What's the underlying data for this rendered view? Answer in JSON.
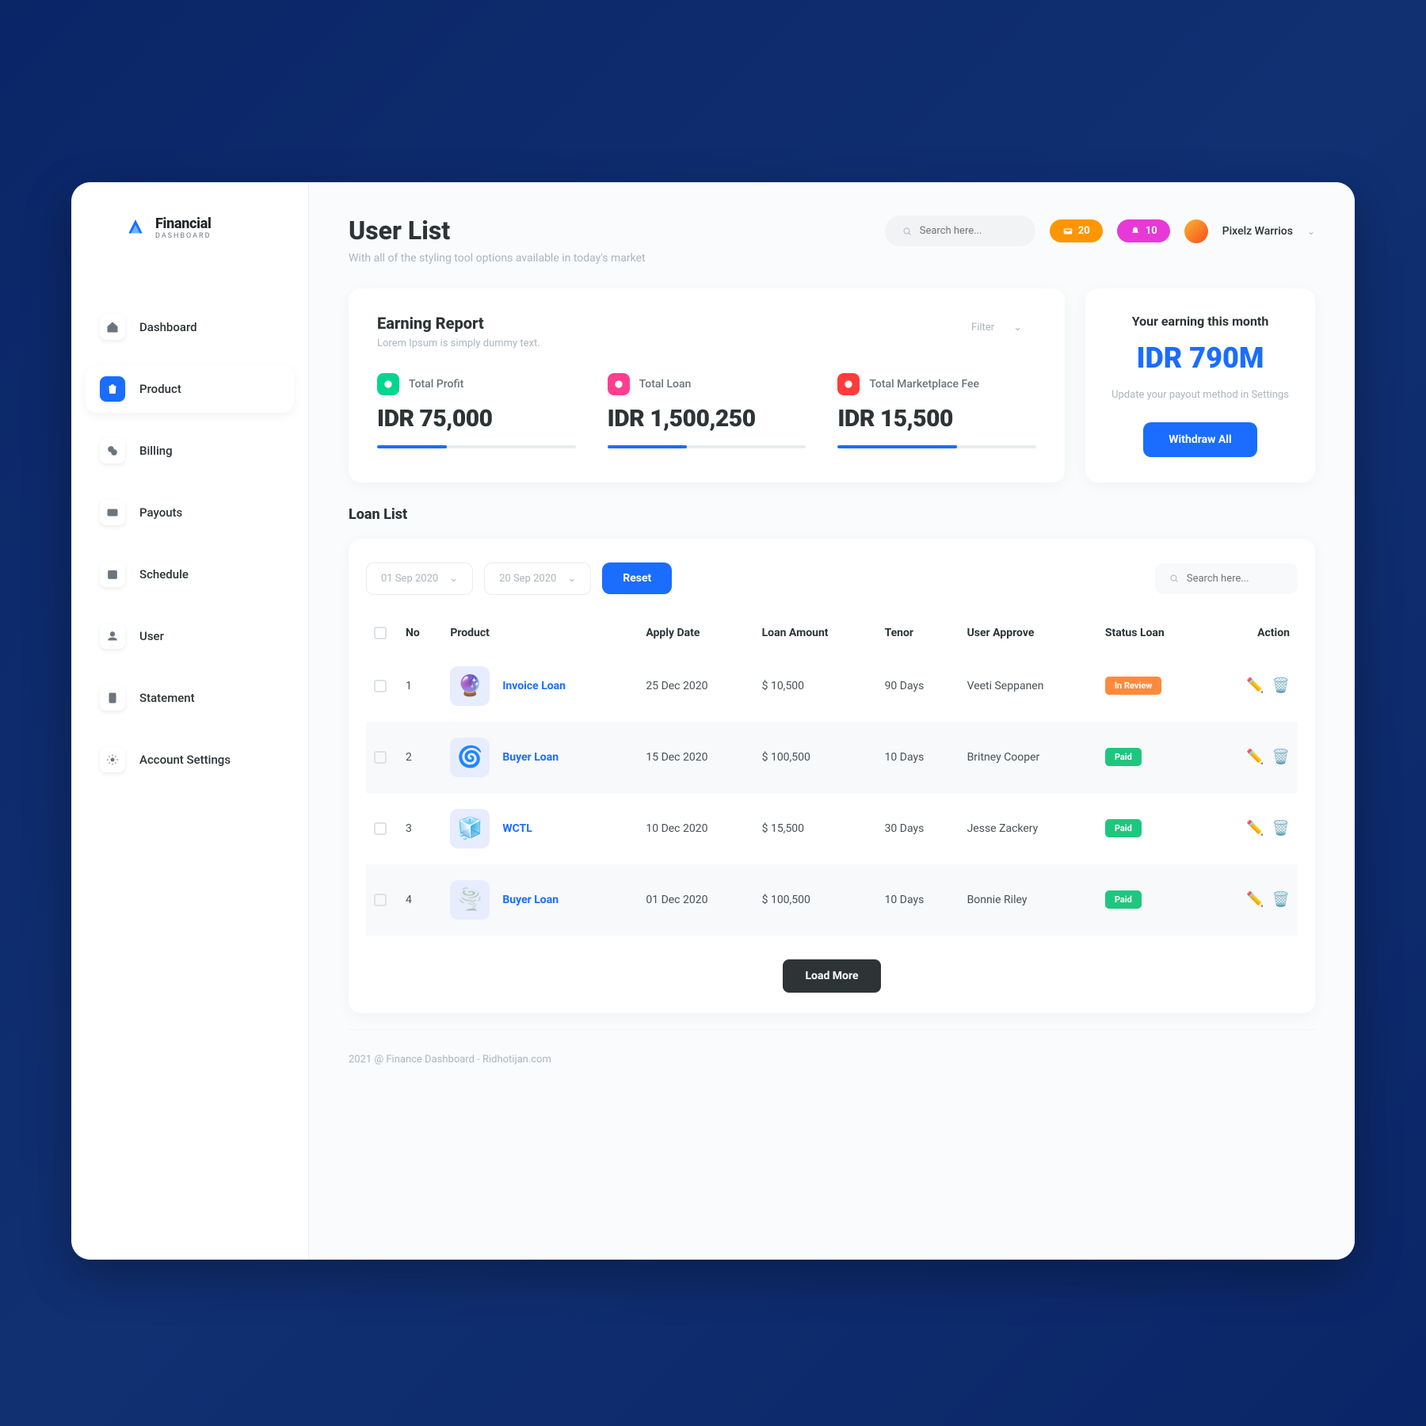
{
  "brand": {
    "title": "Financial",
    "subtitle": "Dashboard"
  },
  "nav": {
    "items": [
      {
        "label": "Dashboard",
        "icon": "home"
      },
      {
        "label": "Product",
        "icon": "bag",
        "active": true
      },
      {
        "label": "Billing",
        "icon": "coins"
      },
      {
        "label": "Payouts",
        "icon": "wallet"
      },
      {
        "label": "Schedule",
        "icon": "calendar"
      },
      {
        "label": "User",
        "icon": "user"
      },
      {
        "label": "Statement",
        "icon": "file"
      },
      {
        "label": "Account Settings",
        "icon": "gear"
      }
    ]
  },
  "header": {
    "title": "User List",
    "subtitle": "With all of the styling tool options available in today's market",
    "search_placeholder": "Search here...",
    "badge_orange": "20",
    "badge_pink": "10",
    "user_name": "Pixelz Warrios"
  },
  "earning": {
    "title": "Earning Report",
    "subtitle": "Lorem Ipsum is simply dummy text.",
    "filter_label": "Filter",
    "metrics": [
      {
        "label": "Total Profit",
        "value": "IDR 75,000",
        "progress": 35,
        "color": "green"
      },
      {
        "label": "Total Loan",
        "value": "IDR 1,500,250",
        "progress": 40,
        "color": "pink"
      },
      {
        "label": "Total Marketplace Fee",
        "value": "IDR 15,500",
        "progress": 60,
        "color": "red"
      }
    ]
  },
  "month": {
    "title": "Your earning this month",
    "value": "IDR 790M",
    "desc": "Update your payout method in Settings",
    "button": "Withdraw All"
  },
  "loan_list": {
    "title": "Loan List",
    "date_from": "01 Sep 2020",
    "date_to": "20 Sep 2020",
    "reset": "Reset",
    "search_placeholder": "Search here...",
    "columns": [
      "No",
      "Product",
      "Apply Date",
      "Loan Amount",
      "Tenor",
      "User Approve",
      "Status Loan",
      "Action"
    ],
    "rows": [
      {
        "no": "1",
        "product": "Invoice Loan",
        "date": "25 Dec 2020",
        "amount": "$ 10,500",
        "tenor": "90 Days",
        "user": "Veeti Seppanen",
        "status": "In Review",
        "status_color": "orange"
      },
      {
        "no": "2",
        "product": "Buyer Loan",
        "date": "15 Dec 2020",
        "amount": "$ 100,500",
        "tenor": "10 Days",
        "user": "Britney Cooper",
        "status": "Paid",
        "status_color": "green"
      },
      {
        "no": "3",
        "product": "WCTL",
        "date": "10 Dec 2020",
        "amount": "$ 15,500",
        "tenor": "30 Days",
        "user": "Jesse Zackery",
        "status": "Paid",
        "status_color": "green"
      },
      {
        "no": "4",
        "product": "Buyer Loan",
        "date": "01 Dec 2020",
        "amount": "$ 100,500",
        "tenor": "10 Days",
        "user": "Bonnie Riley",
        "status": "Paid",
        "status_color": "green"
      }
    ],
    "load_more": "Load More"
  },
  "footer": "2021 @ Finance Dashboard - Ridhotijan.com"
}
